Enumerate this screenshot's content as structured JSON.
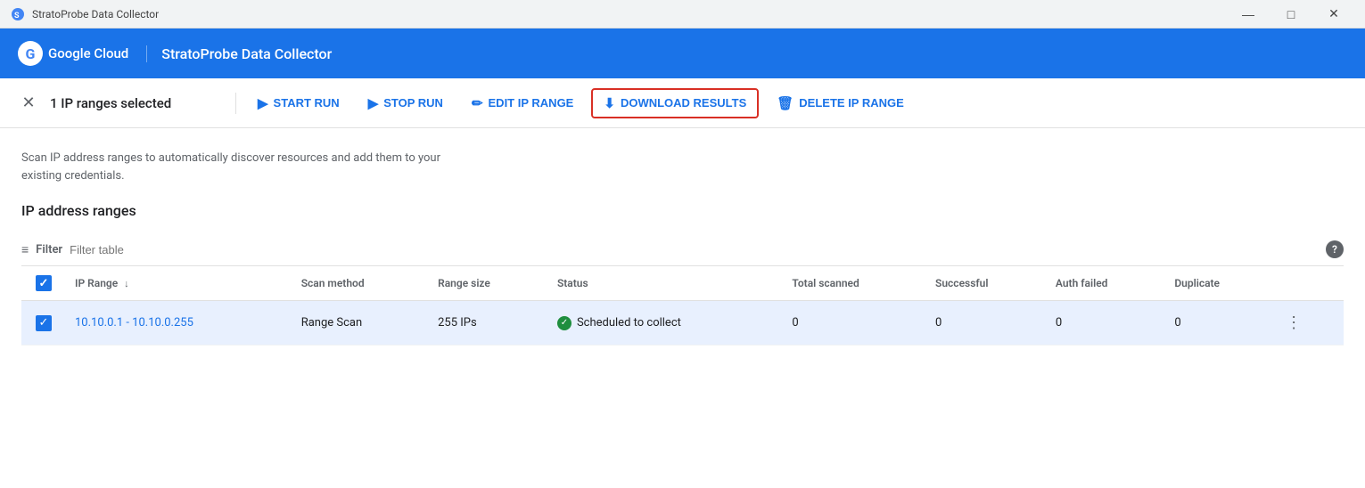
{
  "titleBar": {
    "appName": "StratoProbe Data Collector",
    "controls": {
      "minimize": "—",
      "maximize": "□",
      "close": "✕"
    }
  },
  "header": {
    "logoLetter": "G",
    "cloudLabel": "Google Cloud",
    "appTitle": "StratoProbe Data Collector"
  },
  "toolbar": {
    "closeIcon": "✕",
    "selectionLabel": "1 IP ranges selected",
    "buttons": [
      {
        "id": "start-run",
        "icon": "▶",
        "label": "START RUN",
        "highlighted": false
      },
      {
        "id": "stop-run",
        "icon": "▶",
        "label": "STOP RUN",
        "highlighted": false
      },
      {
        "id": "edit-ip-range",
        "icon": "✎",
        "label": "EDIT IP RANGE",
        "highlighted": false
      },
      {
        "id": "download-results",
        "icon": "⬇",
        "label": "DOWNLOAD RESULTS",
        "highlighted": true
      },
      {
        "id": "delete-ip-range",
        "icon": "🗑",
        "label": "DELETE IP RANGE",
        "highlighted": false
      }
    ]
  },
  "description": "Scan IP address ranges to automatically discover resources and add them to your existing credentials.",
  "sectionTitle": "IP address ranges",
  "filterBar": {
    "icon": "≡",
    "label": "Filter",
    "placeholder": "Filter table",
    "helpIcon": "?"
  },
  "table": {
    "columns": [
      {
        "id": "checkbox",
        "label": ""
      },
      {
        "id": "ip-range",
        "label": "IP Range",
        "sortable": true
      },
      {
        "id": "scan-method",
        "label": "Scan method"
      },
      {
        "id": "range-size",
        "label": "Range size"
      },
      {
        "id": "status",
        "label": "Status"
      },
      {
        "id": "total-scanned",
        "label": "Total scanned"
      },
      {
        "id": "successful",
        "label": "Successful"
      },
      {
        "id": "auth-failed",
        "label": "Auth failed"
      },
      {
        "id": "duplicate",
        "label": "Duplicate"
      },
      {
        "id": "actions",
        "label": ""
      }
    ],
    "rows": [
      {
        "checked": true,
        "ipRange": "10.10.0.1 - 10.10.0.255",
        "scanMethod": "Range Scan",
        "rangeSize": "255 IPs",
        "status": "Scheduled to collect",
        "totalScanned": "0",
        "successful": "0",
        "authFailed": "0",
        "duplicate": "0"
      }
    ]
  }
}
